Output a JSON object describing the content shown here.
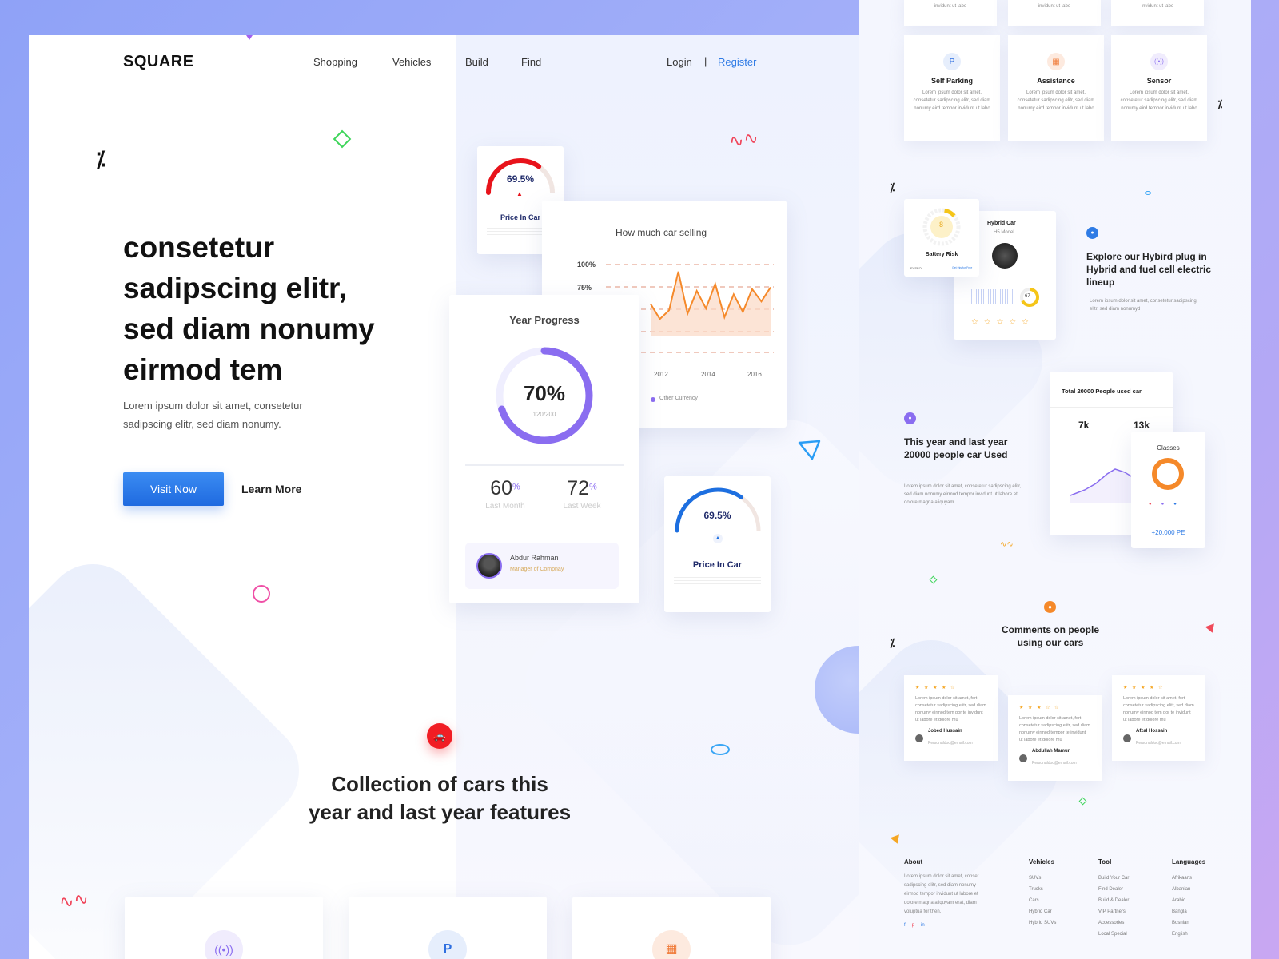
{
  "brand": "SQUARE",
  "nav": {
    "items": [
      "Shopping",
      "Vehicles",
      "Build",
      "Find"
    ],
    "login": "Login",
    "separator": "|",
    "register": "Register"
  },
  "hero": {
    "title_lines": [
      "consetetur",
      "sadipscing elitr,",
      "sed diam nonumy",
      "eirmod tem"
    ],
    "subtitle_lines": [
      "Lorem ipsum dolor sit amet, consetetur",
      "sadipscing elitr, sed diam nonumy."
    ],
    "primary_button": "Visit Now",
    "secondary_button": "Learn More"
  },
  "price_card_top": {
    "value": "69.5%",
    "label": "Price In Car",
    "gauge_color": "#e8131b",
    "level": 0.695
  },
  "selling_chart": {
    "title": "How much car selling",
    "legend": "Other Currency"
  },
  "chart_data": {
    "type": "line",
    "title": "How much car selling",
    "y_ticks": [
      "100%",
      "75%"
    ],
    "x_ticks": [
      "2012",
      "2014",
      "2016"
    ],
    "series": [
      {
        "values": [
          55,
          38,
          48,
          92,
          44,
          70,
          50,
          78,
          40,
          66,
          46,
          72,
          58,
          74
        ]
      }
    ],
    "ylim": [
      0,
      100
    ]
  },
  "year_progress": {
    "title": "Year Progress",
    "percent": "70%",
    "fraction": "120/200",
    "level": 0.7,
    "stats": [
      {
        "value": "60",
        "unit": "%",
        "label": "Last Month"
      },
      {
        "value": "72",
        "unit": "%",
        "label": "Last Week"
      }
    ],
    "person": {
      "name": "Abdur Rahman",
      "role": "Manager of Compnay"
    }
  },
  "price_card_bottom": {
    "value": "69.5%",
    "label": "Price In Car",
    "gauge_color": "#1d6fe0",
    "level": 0.695
  },
  "collection": {
    "title_lines": [
      "Collection of cars this",
      "year and last year features"
    ]
  },
  "side": {
    "features_top": [
      {
        "title": "Self Parking",
        "text": "Lorem ipsum dolor sit amet, consetetur sadipscing elitr, sed diam nonumy eird tempor invidunt ut labo"
      },
      {
        "title": "Assistance",
        "text": "Lorem ipsum dolor sit amet, consetetur sadipscing elitr, sed diam nonumy eird tempor invidunt ut labo"
      },
      {
        "title": "Sensor",
        "text": "Lorem ipsum dolor sit amet, consetetur sadipscing elitr, sed diam nonumy eird tempor invidunt ut labo"
      }
    ],
    "top_partial_text": "invidunt ut labo",
    "battery": {
      "label": "Battery Risk",
      "value": "8",
      "foot_left": "EVSEO",
      "foot_right": "Get this for Free"
    },
    "hybrid": {
      "title": "Hybrid Car",
      "sub": "H5 Model",
      "ring_value": "67",
      "stars": "☆ ☆ ☆ ☆ ☆"
    },
    "explore": {
      "title": "Explore our Hybird plug in Hybrid and fuel cell electric lineup",
      "text": "Lorem ipsum dolor sit amet, consetetur sadipscing elitr, sed diam nonumyd"
    },
    "stats": {
      "title": "This year and last year 20000 people car Used",
      "text": "Lorem ipsum dolor sit amet, consetetur sadipscing elitr, sed diam nonumy eirmod tempor invidunt ut labore et dolore magna aliquyam.",
      "card_title": "Total 20000 People used car",
      "v1": "7k",
      "v2": "13k",
      "classes_title": "Classes",
      "classes_total": "+20,000 PE"
    },
    "comments_title": "Comments on people using our cars",
    "reviews": [
      {
        "stars": "★ ★ ★ ★ ☆",
        "text": "Lorem ipsum dolor sit amet, fort consetetur sadipscing elitr, sed diam nonumy eirmod tem por te invidunt ut labore et dolore mu",
        "name": "Jobed Hussain",
        "email": "Personaldoc@email.com"
      },
      {
        "stars": "★ ★ ★ ☆ ☆",
        "text": "Lorem ipsum dolor sit amet, fort consetetur sadipscing elitr, sed diam nonumy eirmod tempor te invidunt ut labore et dolore mu",
        "name": "Abdullah Mamun",
        "email": "Personaldoc@email.com"
      },
      {
        "stars": "★ ★ ★ ★ ☆",
        "text": "Lorem ipsum dolor sit amet, fort consetetur sadipscing elitr, sed diam nonumy eirmod tem por te invidunt ut labore et dolore mu",
        "name": "Afzal Hossain",
        "email": "Personaldoc@email.com"
      }
    ],
    "footer": {
      "about_title": "About",
      "about_text": "Lorem ipsum dolor sit amet, conset sadipscing elitr, sed diam nonumy eirmod tempor invidunt ut labore et dolore magna aliquyam erat, diam voluptua for then.",
      "cols": [
        {
          "title": "Vehicles",
          "links": [
            "SUVs",
            "Trucks",
            "Cars",
            "Hybrid Car",
            "Hybrid SUVs"
          ]
        },
        {
          "title": "Tool",
          "links": [
            "Build Your Car",
            "Find Dealer",
            "Build & Dealer",
            "VIP Partners",
            "Accessories",
            "Local Special"
          ]
        },
        {
          "title": "Languages",
          "links": [
            "Afrikaans",
            "Albanian",
            "Arabic",
            "Bangla",
            "Bosnian",
            "English"
          ]
        }
      ],
      "social": [
        "f",
        "p",
        "in"
      ]
    }
  }
}
